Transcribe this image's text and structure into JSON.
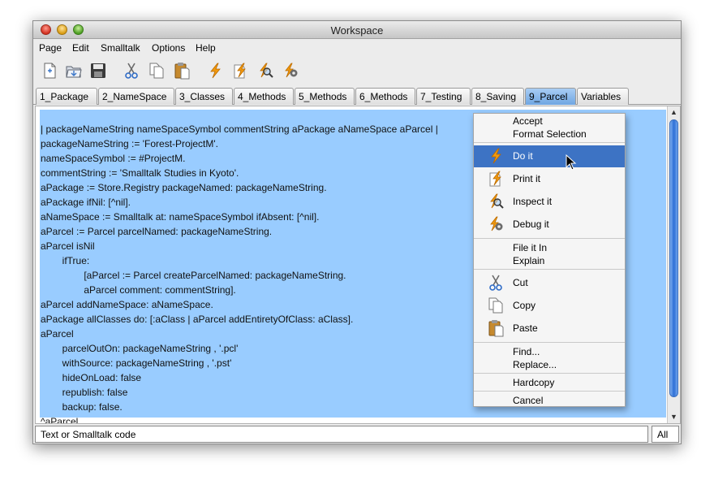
{
  "window": {
    "title": "Workspace"
  },
  "menubar": {
    "items": [
      "Page",
      "Edit",
      "Smalltalk",
      "Options",
      "Help"
    ]
  },
  "toolbar": {
    "icons": [
      "new-page-icon",
      "open-folder-icon",
      "save-disk-icon",
      "cut-scissors-icon",
      "copy-pages-icon",
      "paste-clipboard-icon",
      "do-it-lightning-icon",
      "print-it-icon",
      "inspect-it-icon",
      "debug-it-icon"
    ]
  },
  "tabs": {
    "items": [
      "1_Package",
      "2_NameSpace",
      "3_Classes",
      "4_Methods",
      "5_Methods",
      "6_Methods",
      "7_Testing",
      "8_Saving",
      "9_Parcel",
      "Variables"
    ],
    "selected": "9_Parcel"
  },
  "editor": {
    "lines": [
      "| packageNameString nameSpaceSymbol commentString aPackage aNameSpace aParcel |",
      "packageNameString := 'Forest-ProjectM'.",
      "nameSpaceSymbol := #ProjectM.",
      "commentString := 'Smalltalk Studies in Kyoto'.",
      "aPackage := Store.Registry packageNamed: packageNameString.",
      "aPackage ifNil: [^nil].",
      "aNameSpace := Smalltalk at: nameSpaceSymbol ifAbsent: [^nil].",
      "aParcel := Parcel parcelNamed: packageNameString.",
      "aParcel isNil",
      "        ifTrue:",
      "                [aParcel := Parcel createParcelNamed: packageNameString.",
      "                aParcel comment: commentString].",
      "aParcel addNameSpace: aNameSpace.",
      "aPackage allClasses do: [:aClass | aParcel addEntiretyOfClass: aClass].",
      "aParcel",
      "        parcelOutOn: packageNameString , '.pcl'",
      "        withSource: packageNameString , '.pst'",
      "        hideOnLoad: false",
      "        republish: false",
      "        backup: false.",
      "^aParcel"
    ]
  },
  "status": {
    "text": "Text or Smalltalk code",
    "scope": "All"
  },
  "context_menu": {
    "accept": "Accept",
    "format_selection": "Format Selection",
    "do_it": "Do it",
    "print_it": "Print it",
    "inspect_it": "Inspect it",
    "debug_it": "Debug it",
    "file_it_in": "File it In",
    "explain": "Explain",
    "cut": "Cut",
    "copy": "Copy",
    "paste": "Paste",
    "find": "Find...",
    "replace": "Replace...",
    "hardcopy": "Hardcopy",
    "cancel": "Cancel",
    "highlighted": "Do it"
  },
  "colors": {
    "selection": "#99ccff",
    "highlight": "#3d73c4",
    "tab_selected": "#6fa6e2",
    "scroll_thumb": "#2e6fd6"
  }
}
